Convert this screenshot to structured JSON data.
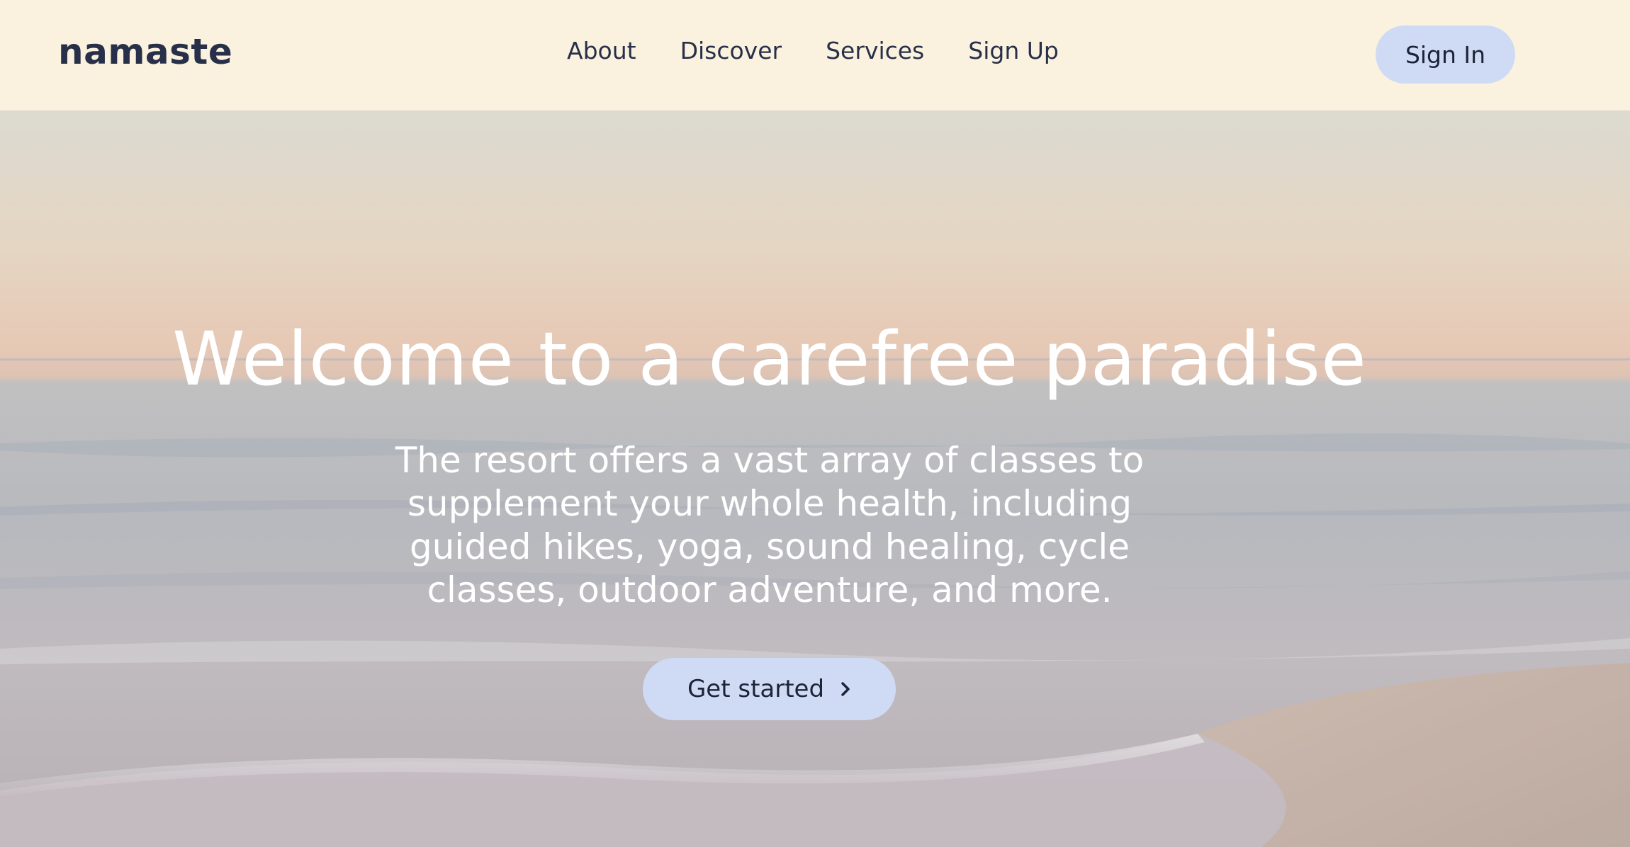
{
  "brand": {
    "logo": "namaste"
  },
  "nav": {
    "links": [
      "About",
      "Discover",
      "Services",
      "Sign Up"
    ],
    "signin_label": "Sign In"
  },
  "hero": {
    "headline": "Welcome to a carefree paradise",
    "description": "The resort offers a vast array of classes to supplement your whole health, including guided hikes, yoga, sound healing, cycle classes, outdoor adventure, and more.",
    "cta_label": "Get started",
    "cta_icon": "chevron-right-icon"
  },
  "colors": {
    "nav_background": "#faf2df",
    "text_dark": "#283049",
    "button_background": "#cfdbf4",
    "hero_text": "#ffffff"
  }
}
